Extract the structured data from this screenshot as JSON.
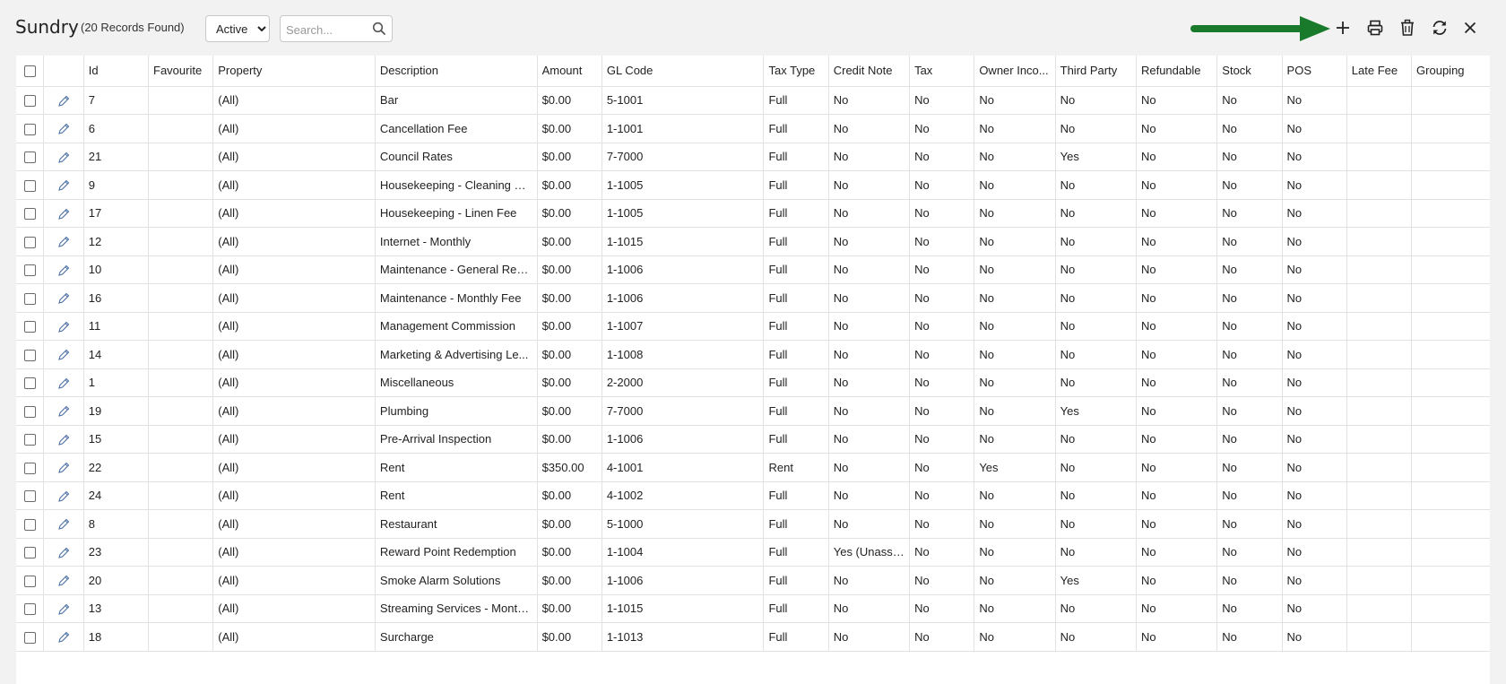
{
  "header": {
    "title": "Sundry",
    "record_count": "(20 Records Found)",
    "status_options": [
      "Active"
    ],
    "status_selected": "Active",
    "search_placeholder": "Search..."
  },
  "toolbar": {
    "buttons": [
      "plus-icon",
      "print-icon",
      "trash-icon",
      "refresh-icon",
      "close-icon"
    ],
    "arrow_color": "#1a7a2c"
  },
  "table": {
    "columns": [
      "",
      "",
      "Id",
      "Favourite",
      "Property",
      "Description",
      "Amount",
      "GL Code",
      "Tax Type",
      "Credit Note",
      "Tax",
      "Owner Inco...",
      "Third Party",
      "Refundable",
      "Stock",
      "POS",
      "Late Fee",
      "Grouping"
    ],
    "rows": [
      [
        "7",
        "",
        "(All)",
        "Bar",
        "$0.00",
        "5-1001",
        "Full",
        "No",
        "No",
        "No",
        "No",
        "No",
        "No",
        "No",
        "",
        ""
      ],
      [
        "6",
        "",
        "(All)",
        "Cancellation Fee",
        "$0.00",
        "1-1001",
        "Full",
        "No",
        "No",
        "No",
        "No",
        "No",
        "No",
        "No",
        "",
        ""
      ],
      [
        "21",
        "",
        "(All)",
        "Council Rates",
        "$0.00",
        "7-7000",
        "Full",
        "No",
        "No",
        "No",
        "Yes",
        "No",
        "No",
        "No",
        "",
        ""
      ],
      [
        "9",
        "",
        "(All)",
        "Housekeeping - Cleaning Fee",
        "$0.00",
        "1-1005",
        "Full",
        "No",
        "No",
        "No",
        "No",
        "No",
        "No",
        "No",
        "",
        ""
      ],
      [
        "17",
        "",
        "(All)",
        "Housekeeping - Linen Fee",
        "$0.00",
        "1-1005",
        "Full",
        "No",
        "No",
        "No",
        "No",
        "No",
        "No",
        "No",
        "",
        ""
      ],
      [
        "12",
        "",
        "(All)",
        "Internet - Monthly",
        "$0.00",
        "1-1015",
        "Full",
        "No",
        "No",
        "No",
        "No",
        "No",
        "No",
        "No",
        "",
        ""
      ],
      [
        "10",
        "",
        "(All)",
        "Maintenance - General Rep...",
        "$0.00",
        "1-1006",
        "Full",
        "No",
        "No",
        "No",
        "No",
        "No",
        "No",
        "No",
        "",
        ""
      ],
      [
        "16",
        "",
        "(All)",
        "Maintenance - Monthly Fee",
        "$0.00",
        "1-1006",
        "Full",
        "No",
        "No",
        "No",
        "No",
        "No",
        "No",
        "No",
        "",
        ""
      ],
      [
        "11",
        "",
        "(All)",
        "Management Commission",
        "$0.00",
        "1-1007",
        "Full",
        "No",
        "No",
        "No",
        "No",
        "No",
        "No",
        "No",
        "",
        ""
      ],
      [
        "14",
        "",
        "(All)",
        "Marketing & Advertising Le...",
        "$0.00",
        "1-1008",
        "Full",
        "No",
        "No",
        "No",
        "No",
        "No",
        "No",
        "No",
        "",
        ""
      ],
      [
        "1",
        "",
        "(All)",
        "Miscellaneous",
        "$0.00",
        "2-2000",
        "Full",
        "No",
        "No",
        "No",
        "No",
        "No",
        "No",
        "No",
        "",
        ""
      ],
      [
        "19",
        "",
        "(All)",
        "Plumbing",
        "$0.00",
        "7-7000",
        "Full",
        "No",
        "No",
        "No",
        "Yes",
        "No",
        "No",
        "No",
        "",
        ""
      ],
      [
        "15",
        "",
        "(All)",
        "Pre-Arrival Inspection",
        "$0.00",
        "1-1006",
        "Full",
        "No",
        "No",
        "No",
        "No",
        "No",
        "No",
        "No",
        "",
        ""
      ],
      [
        "22",
        "",
        "(All)",
        "Rent",
        "$350.00",
        "4-1001",
        "Rent",
        "No",
        "No",
        "Yes",
        "No",
        "No",
        "No",
        "No",
        "",
        ""
      ],
      [
        "24",
        "",
        "(All)",
        "Rent",
        "$0.00",
        "4-1002",
        "Full",
        "No",
        "No",
        "No",
        "No",
        "No",
        "No",
        "No",
        "",
        ""
      ],
      [
        "8",
        "",
        "(All)",
        "Restaurant",
        "$0.00",
        "5-1000",
        "Full",
        "No",
        "No",
        "No",
        "No",
        "No",
        "No",
        "No",
        "",
        ""
      ],
      [
        "23",
        "",
        "(All)",
        "Reward Point Redemption",
        "$0.00",
        "1-1004",
        "Full",
        "Yes (Unassi...",
        "No",
        "No",
        "No",
        "No",
        "No",
        "No",
        "",
        ""
      ],
      [
        "20",
        "",
        "(All)",
        "Smoke Alarm Solutions",
        "$0.00",
        "1-1006",
        "Full",
        "No",
        "No",
        "No",
        "Yes",
        "No",
        "No",
        "No",
        "",
        ""
      ],
      [
        "13",
        "",
        "(All)",
        "Streaming Services - Monthly",
        "$0.00",
        "1-1015",
        "Full",
        "No",
        "No",
        "No",
        "No",
        "No",
        "No",
        "No",
        "",
        ""
      ],
      [
        "18",
        "",
        "(All)",
        "Surcharge",
        "$0.00",
        "1-1013",
        "Full",
        "No",
        "No",
        "No",
        "No",
        "No",
        "No",
        "No",
        "",
        ""
      ]
    ]
  }
}
